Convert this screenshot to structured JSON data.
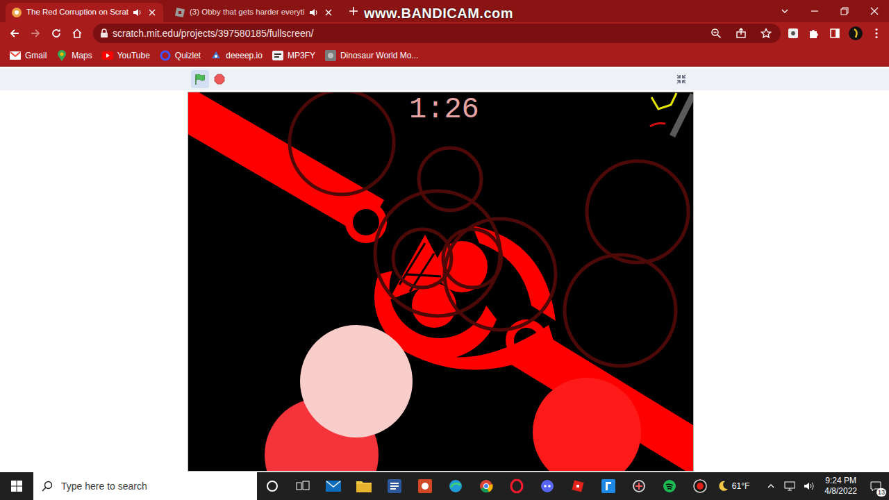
{
  "window": {
    "watermark": "www.BANDICAM.com"
  },
  "tabs": [
    {
      "label": "The Red Corruption on Scrat",
      "selected": true,
      "audio": true
    },
    {
      "label": "(3) Obby that gets harder everyti",
      "selected": false,
      "audio": false
    }
  ],
  "toolbar": {
    "url": "scratch.mit.edu/projects/397580185/fullscreen/",
    "forward_disabled": true
  },
  "bookmarks": [
    {
      "label": "Gmail"
    },
    {
      "label": "Maps"
    },
    {
      "label": "YouTube"
    },
    {
      "label": "Quizlet"
    },
    {
      "label": "deeeep.io"
    },
    {
      "label": "MP3FY"
    },
    {
      "label": "Dinosaur World Mo..."
    }
  ],
  "player": {
    "running": true,
    "timer": "1:26"
  },
  "taskbar": {
    "search_placeholder": "Type here to search",
    "weather": "61°F",
    "time": "9:24 PM",
    "date": "4/8/2022",
    "notifications": "13"
  }
}
